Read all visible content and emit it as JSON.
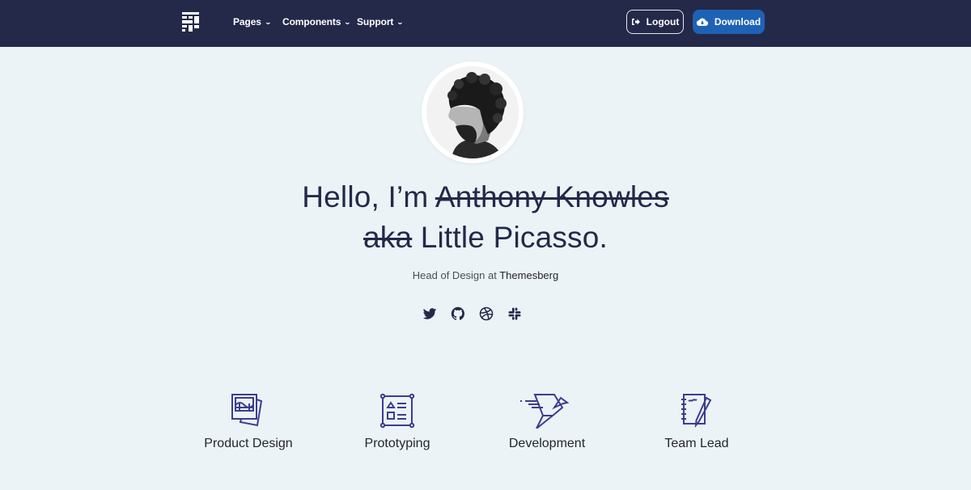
{
  "navbar": {
    "logo_icon": "brand-logo-icon",
    "items": [
      {
        "label": "Pages",
        "icon": "chevron-down-icon"
      },
      {
        "label": "Components",
        "icon": "chevron-down-icon"
      },
      {
        "label": "Support",
        "icon": "chevron-down-icon"
      }
    ],
    "logout_label": "Logout",
    "logout_icon": "sign-out-icon",
    "download_label": "Download",
    "download_icon": "cloud-download-icon",
    "accent_color": "#1e62b6",
    "bg_color": "#24294a"
  },
  "profile": {
    "avatar_alt": "Profile portrait",
    "headline_prefix": "Hello, I’m ",
    "headline_struck_name": "Anthony Knowles",
    "headline_struck_aka": "aka",
    "headline_suffix": " Little Picasso.",
    "subtitle_prefix": "Head of Design at ",
    "subtitle_company": "Themesberg",
    "socials": [
      {
        "name": "twitter-icon"
      },
      {
        "name": "github-icon"
      },
      {
        "name": "dribbble-icon"
      },
      {
        "name": "slack-icon"
      }
    ]
  },
  "features": [
    {
      "label": "Product Design",
      "icon": "photos-icon"
    },
    {
      "label": "Prototyping",
      "icon": "wireframe-icon"
    },
    {
      "label": "Development",
      "icon": "paper-bird-icon"
    },
    {
      "label": "Team Lead",
      "icon": "notebook-pen-icon"
    }
  ]
}
